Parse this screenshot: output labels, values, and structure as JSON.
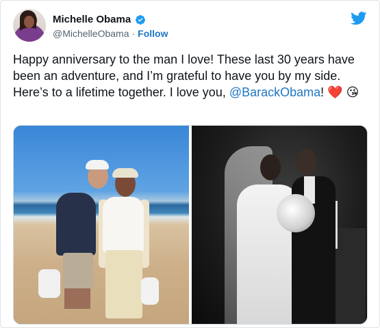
{
  "header": {
    "display_name": "Michelle Obama",
    "handle": "@MichelleObama",
    "separator": "·",
    "follow_label": "Follow",
    "verified_icon": "verified-badge-icon",
    "brand_icon": "twitter-bird-icon"
  },
  "tweet": {
    "text": "Happy anniversary to the man I love! These last 30 years have been an adventure, and I’m grateful to have you by my side. Here’s to a lifetime together. I love you, ",
    "mention": "@BarackObama",
    "after_mention": "!",
    "emoji_1": "❤️",
    "emoji_2": "😘"
  },
  "media": {
    "photos": [
      {
        "name": "beach-photo"
      },
      {
        "name": "wedding-photo"
      }
    ]
  },
  "colors": {
    "link": "#1d77c2",
    "twitter_blue": "#1d9bf0",
    "text": "#0f1419",
    "muted": "#536471"
  }
}
